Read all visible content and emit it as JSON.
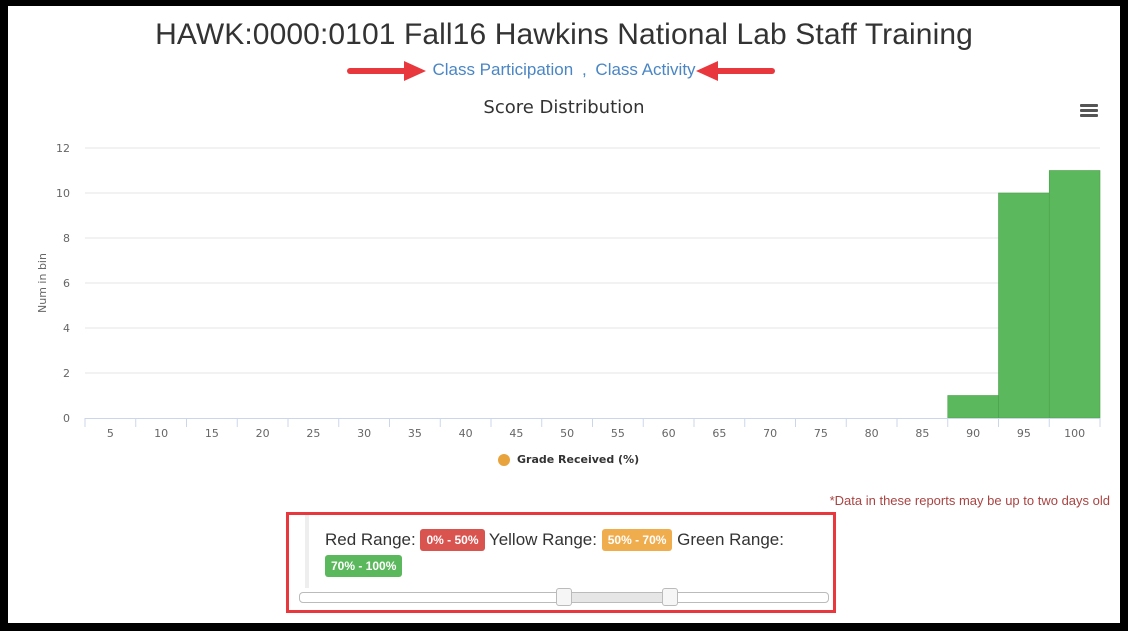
{
  "header": {
    "title": "HAWK:0000:0101 Fall16 Hawkins National Lab Staff Training",
    "links": [
      {
        "label": "Class Participation"
      },
      {
        "label": "Class Activity"
      }
    ],
    "link_separator": ","
  },
  "chart_data": {
    "type": "bar",
    "title": "Score Distribution",
    "xlabel": "",
    "ylabel": "Num in bin",
    "categories": [
      "5",
      "10",
      "15",
      "20",
      "25",
      "30",
      "35",
      "40",
      "45",
      "50",
      "55",
      "60",
      "65",
      "70",
      "75",
      "80",
      "85",
      "90",
      "95",
      "100"
    ],
    "series": [
      {
        "name": "Grade Received (%)",
        "values": [
          0,
          0,
          0,
          0,
          0,
          0,
          0,
          0,
          0,
          0,
          0,
          0,
          0,
          0,
          0,
          0,
          0,
          1,
          10,
          11
        ]
      }
    ],
    "ylim": [
      0,
      12
    ],
    "yticks": [
      0,
      2,
      4,
      6,
      8,
      10,
      12
    ],
    "grid": true,
    "legend": "bottom-center",
    "bar_color": "#5cb85c",
    "legend_color": "#e8a33d"
  },
  "disclaimer": "*Data in these reports may be up to two days old",
  "ranges": {
    "red_label": "Red Range:",
    "red_value": "0% - 50%",
    "yellow_label": "Yellow Range:",
    "yellow_value": "50% - 70%",
    "green_label": "Green Range:",
    "green_value": "70% - 100%",
    "slider_low": 50,
    "slider_high": 70,
    "colors": {
      "red": "#d9534f",
      "yellow": "#f0ad4e",
      "green": "#5cb85c"
    }
  },
  "icons": {
    "menu": "hamburger-menu-icon",
    "arrow_left": "red-arrow-right-icon",
    "arrow_right": "red-arrow-left-icon"
  }
}
